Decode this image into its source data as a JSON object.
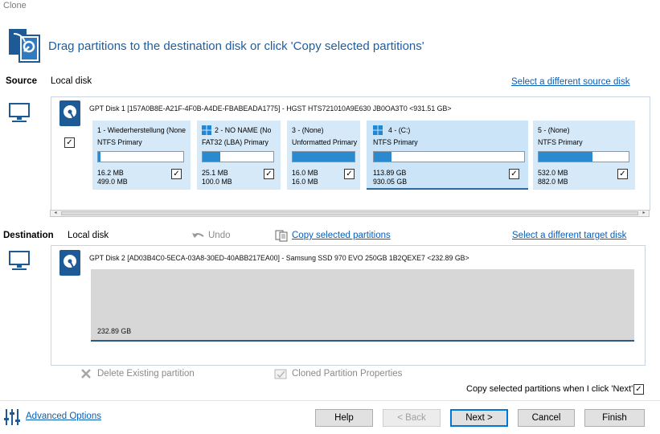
{
  "window": {
    "title": "Clone"
  },
  "header": {
    "instruction": "Drag partitions to the destination disk or click 'Copy selected partitions'"
  },
  "source": {
    "label": "Source",
    "disk_type": "Local disk",
    "select_link": "Select a different source disk",
    "disk_info": "GPT Disk 1 [157A0B8E-A21F-4F0B-A4DE-FBABEADA1775] - HGST HTS721010A9E630 JB0OA3T0  <931.51 GB>",
    "disk_checked": true,
    "partitions": [
      {
        "title": "1 - Wiederherstellung (None",
        "type": "NTFS Primary",
        "used": "16.2 MB",
        "total": "499.0 MB",
        "fill_fraction": 0.03,
        "checked": true,
        "windows_icon": false
      },
      {
        "title": "2 - NO NAME (No",
        "type": "FAT32 (LBA) Primary",
        "used": "25.1 MB",
        "total": "100.0 MB",
        "fill_fraction": 0.25,
        "checked": true,
        "windows_icon": true
      },
      {
        "title": "3 - (None)",
        "type": "Unformatted Primary",
        "used": "16.0 MB",
        "total": "16.0 MB",
        "fill_fraction": 1.0,
        "checked": true,
        "windows_icon": false
      },
      {
        "title": "4 - (C:)",
        "type": "NTFS Primary",
        "used": "113.89 GB",
        "total": "930.05 GB",
        "fill_fraction": 0.12,
        "checked": true,
        "windows_icon": true
      },
      {
        "title": "5 - (None)",
        "type": "NTFS Primary",
        "used": "532.0 MB",
        "total": "882.0 MB",
        "fill_fraction": 0.6,
        "checked": true,
        "windows_icon": false
      }
    ]
  },
  "destination": {
    "label": "Destination",
    "disk_type": "Local disk",
    "undo_label": "Undo",
    "copy_link": "Copy selected partitions",
    "select_link": "Select a different target disk",
    "disk_info": "GPT Disk 2 [AD03B4C0-5ECA-03A8-30ED-40ABB217EA00] - Samsung SSD 970 EVO 250GB 1B2QEXE7  <232.89 GB>",
    "unallocated": "232.89 GB",
    "delete_label": "Delete Existing partition",
    "properties_label": "Cloned Partition Properties"
  },
  "option": {
    "copy_on_next_label": "Copy selected partitions when I click 'Next'",
    "checked": true
  },
  "footer": {
    "advanced_link": "Advanced Options",
    "buttons": {
      "help": "Help",
      "back": "< Back",
      "next": "Next >",
      "cancel": "Cancel",
      "finish": "Finish"
    }
  },
  "colors": {
    "accent": "#1f5d9c",
    "link": "#0a5db5",
    "partition_bg": "#d6e9f8",
    "fill": "#2a8ad0"
  }
}
